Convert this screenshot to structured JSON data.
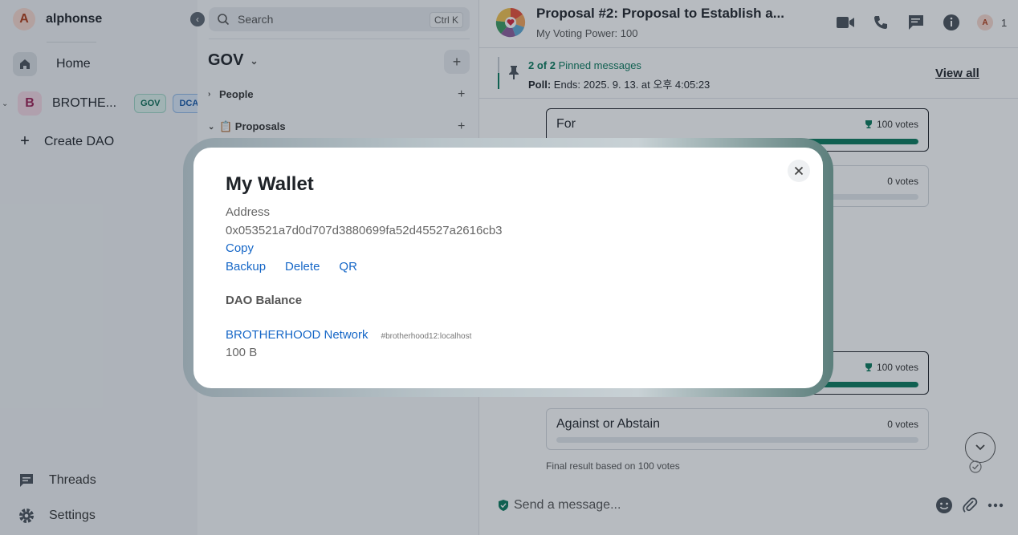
{
  "user": {
    "initial": "A",
    "name": "alphonse"
  },
  "nav": {
    "home_label": "Home",
    "space": {
      "initial": "B",
      "name": "BROTHE...",
      "badges": [
        "GOV",
        "DCA"
      ]
    },
    "create_label": "Create DAO",
    "threads_label": "Threads",
    "settings_label": "Settings"
  },
  "roomlist": {
    "search_placeholder": "Search",
    "search_shortcut": "Ctrl K",
    "space_title": "GOV",
    "sections": [
      {
        "label": "People"
      },
      {
        "label": "📋 Proposals"
      }
    ]
  },
  "room": {
    "title": "Proposal #2: Proposal to Establish a...",
    "subtitle": "My Voting Power: 100",
    "member_count": "1",
    "member_initial": "A"
  },
  "pinned": {
    "count_bold": "2 of 2",
    "count_rest": "Pinned messages",
    "label_bold": "Poll:",
    "text": "Ends: 2025. 9. 13. at 오후 4:05:23",
    "view_all": "View all"
  },
  "poll_top": [
    {
      "label": "For",
      "votes": "100 votes",
      "fraction": 1.0
    },
    {
      "label": "",
      "votes": "0 votes",
      "fraction": 0.0
    }
  ],
  "poll_bottom": [
    {
      "label": "",
      "votes": "100 votes",
      "fraction": 1.0
    },
    {
      "label": "Against or Abstain",
      "votes": "0 votes",
      "fraction": 0.0
    }
  ],
  "final_note": "Final result based on 100 votes",
  "composer_placeholder": "Send a message...",
  "modal": {
    "title": "My Wallet",
    "address_label": "Address",
    "address": "0x053521a7d0d707d3880699fa52d45527a2616cb3",
    "copy": "Copy",
    "actions": [
      "Backup",
      "Delete",
      "QR"
    ],
    "dao_label": "DAO Balance",
    "dao_name": "BROTHERHOOD Network",
    "dao_id": "#brotherhood12:localhost",
    "dao_balance": "100 B"
  },
  "colors": {
    "accent": "#0a7a5c",
    "link": "#1667c7"
  }
}
